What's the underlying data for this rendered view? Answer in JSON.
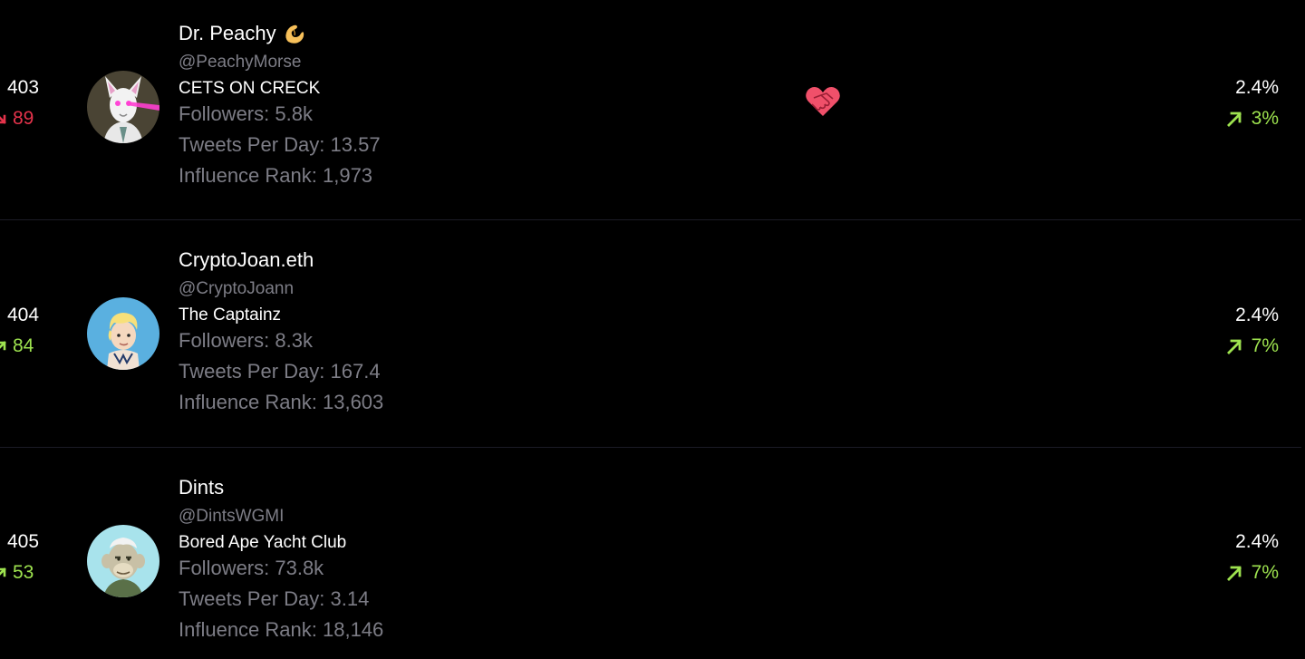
{
  "theme": {
    "background": "#000000",
    "up_color": "#9ee34f",
    "down_color": "#e5334b",
    "muted_text": "#7d7d86"
  },
  "rows": [
    {
      "rank": "403",
      "rank_change": "89",
      "rank_change_direction": "down",
      "avatar_icon": "white-cat-laser-eyes-avatar",
      "name": "Dr. Peachy",
      "name_emoji": "pinching-hand-emoji",
      "handle": "@PeachyMorse",
      "collection": "CETS ON CRECK",
      "followers": "Followers: 5.8k",
      "tweets_per_day": "Tweets Per Day: 13.57",
      "influence_rank": "Influence Rank: 1,973",
      "badge_icon": "heart-handshake-icon",
      "percent": "2.4%",
      "percent_change": "3%",
      "percent_change_direction": "up"
    },
    {
      "rank": "404",
      "rank_change": "84",
      "rank_change_direction": "up",
      "avatar_icon": "blonde-captain-avatar",
      "name": "CryptoJoan.eth",
      "handle": "@CryptoJoann",
      "collection": "The Captainz",
      "followers": "Followers: 8.3k",
      "tweets_per_day": "Tweets Per Day: 167.4",
      "influence_rank": "Influence Rank: 13,603",
      "percent": "2.4%",
      "percent_change": "7%",
      "percent_change_direction": "up"
    },
    {
      "rank": "405",
      "rank_change": "53",
      "rank_change_direction": "up",
      "avatar_icon": "bored-ape-avatar",
      "name": "Dints",
      "handle": "@DintsWGMI",
      "collection": "Bored Ape Yacht Club",
      "followers": "Followers: 73.8k",
      "tweets_per_day": "Tweets Per Day: 3.14",
      "influence_rank": "Influence Rank: 18,146",
      "percent": "2.4%",
      "percent_change": "7%",
      "percent_change_direction": "up"
    }
  ]
}
